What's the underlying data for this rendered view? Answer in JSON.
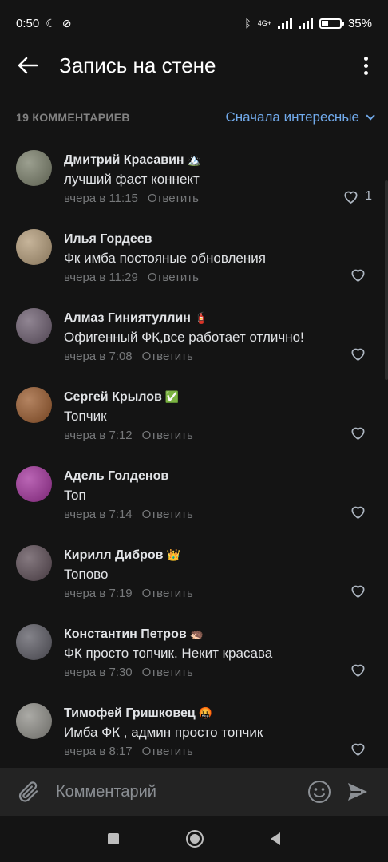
{
  "status": {
    "time": "0:50",
    "battery": "35%",
    "battery_level": 0.35,
    "network": "4G+",
    "signal_icon": "signal-icon"
  },
  "header": {
    "title": "Запись на стене"
  },
  "comments_bar": {
    "count_label": "19 КОММЕНТАРИЕВ",
    "sort_label": "Сначала интересные"
  },
  "comments": [
    {
      "name": "Дмитрий Красавин",
      "badge": "🏔️",
      "text": "лучший фаст коннект",
      "time": "вчера в 11:15",
      "reply": "Ответить",
      "likes": "1",
      "avatar_color": "#7a7f6a"
    },
    {
      "name": "Илья Гордеев",
      "badge": "",
      "text": "Фк имба постояные обновления",
      "time": "вчера в 11:29",
      "reply": "Ответить",
      "likes": "",
      "avatar_color": "#b39b78"
    },
    {
      "name": "Алмаз Гиниятуллин",
      "badge": "🧯",
      "text": "Офигенный ФК,все работает отлично!",
      "time": "вчера в 7:08",
      "reply": "Ответить",
      "likes": "",
      "avatar_color": "#6b5c6e"
    },
    {
      "name": "Сергей Крылов",
      "badge": "✅",
      "text": "Топчик",
      "time": "вчера в 7:12",
      "reply": "Ответить",
      "likes": "",
      "avatar_color": "#9a5a2c"
    },
    {
      "name": "Адель Голденов",
      "badge": "",
      "text": "Топ",
      "time": "вчера в 7:14",
      "reply": "Ответить",
      "likes": "",
      "avatar_color": "#a3329c"
    },
    {
      "name": "Кирилл Дибров",
      "badge": "👑",
      "text": "Топово",
      "time": "вчера в 7:19",
      "reply": "Ответить",
      "likes": "",
      "avatar_color": "#5c4c55"
    },
    {
      "name": "Константин Петров",
      "badge": "🦔",
      "text": "ФК просто топчик. Некит красава",
      "time": "вчера в 7:30",
      "reply": "Ответить",
      "likes": "",
      "avatar_color": "#5b5a63"
    },
    {
      "name": "Тимофей Гришковец",
      "badge": "🤬",
      "text": "Имба ФК , админ просто топчик",
      "time": "вчера в 8:17",
      "reply": "Ответить",
      "likes": "",
      "avatar_color": "#8f8e88"
    }
  ],
  "composer": {
    "placeholder": "Комментарий"
  },
  "colors": {
    "background": "#141414",
    "accent": "#71aaeb",
    "secondary_text": "#76787a"
  }
}
